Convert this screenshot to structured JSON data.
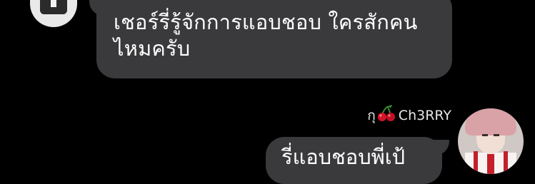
{
  "messages": [
    {
      "side": "left",
      "line1": "เชอร์รี่รู้จักการแอบชอบ ใครสักคน",
      "line2": "ไหมครับ"
    },
    {
      "side": "right",
      "text": "รี่แอบชอบพี่เป้"
    }
  ],
  "sender": {
    "name_prefix": "กุ",
    "emoji": "cherry-icon",
    "name_suffix": "Ch3RRY"
  },
  "colors": {
    "background": "#000000",
    "bubble": "#3a3a3c",
    "text": "#ffffff",
    "cherry": "#d4142a"
  }
}
